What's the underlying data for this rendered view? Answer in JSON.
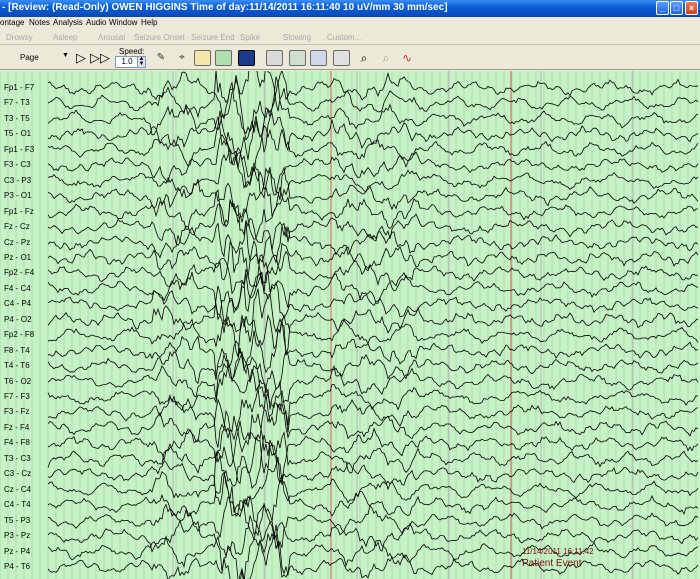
{
  "window": {
    "title": "- [Review: (Read-Only)    OWEN HIGGINS    Time of day:11/14/2011 16:11:40    10 uV/mm    30 mm/sec]",
    "controls": {
      "minimize": "_",
      "maximize": "□",
      "close": "×"
    }
  },
  "menu": [
    "ontage",
    "Notes",
    "Analysis",
    "Audio",
    "Window",
    "Help"
  ],
  "annotations": [
    "Drowsy",
    "Asleep",
    "Arousal",
    "Seizure Onset",
    "Seizure End",
    "Spike",
    "Slowing",
    "Custom..."
  ],
  "toolbar": {
    "page_value": "Page",
    "speed_label": "Speed:",
    "speed_value": "1.0",
    "icons": [
      "play-icon",
      "fast-forward-icon",
      "marker-tool-icon",
      "annotation-tool-icon",
      "dsa-icon",
      "spectral-icon",
      "montage-icon",
      "patient-video-icon",
      "camera-icon",
      "report-icon",
      "print-icon",
      "zoom-in-icon",
      "zoom-out-icon",
      "spike-detect-icon"
    ]
  },
  "eeg": {
    "channels": [
      "Fp1 - F7",
      "F7 - T3",
      "T3 - T5",
      "T5 - O1",
      "Fp1 - F3",
      "F3 - C3",
      "C3 - P3",
      "P3 - O1",
      "Fp1 - Fz",
      "Fz - Cz",
      "Cz - Pz",
      "Pz - O1",
      "Fp2 - F4",
      "F4 - C4",
      "C4 - P4",
      "P4 - O2",
      "Fp2 - F8",
      "F8 - T4",
      "T4 - T6",
      "T6 - O2",
      "F7 - F3",
      "F3 - Fz",
      "Fz - F4",
      "F4 - F8",
      "T3 - C3",
      "C3 - Cz",
      "Cz - C4",
      "C4 - T4",
      "T5 - P3",
      "P3 - Pz",
      "Pz - P4",
      "P4 - T6"
    ],
    "event": {
      "time": "11/14/2011 16:11:42",
      "label": "Patient Event"
    },
    "colors": {
      "background": "#c6f2c6",
      "grid": "#8fcf8f",
      "second_line": "#b8b8b8",
      "marker": "#e05a5a",
      "trace": "#000000"
    }
  }
}
